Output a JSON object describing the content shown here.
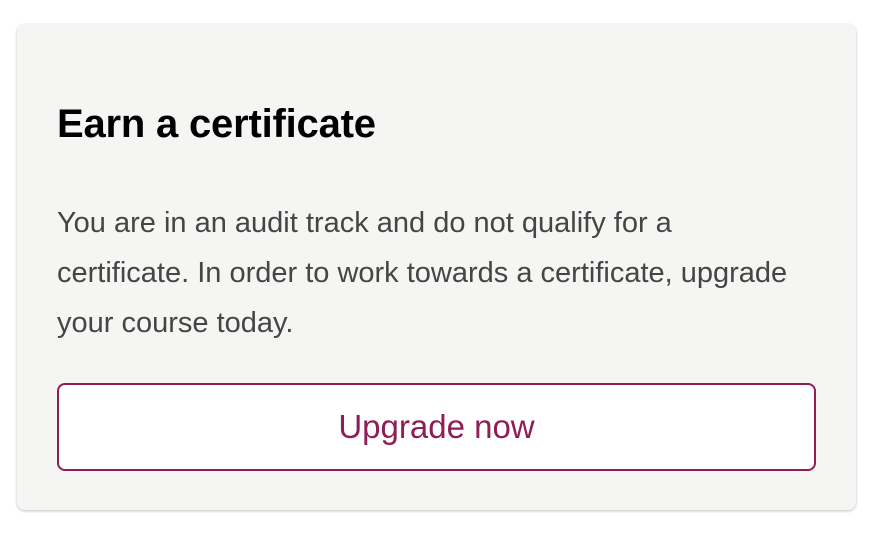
{
  "card": {
    "title": "Earn a certificate",
    "description": "You are in an audit track and do not qualify for a certificate. In order to work towards a certificate, upgrade your course today.",
    "button_label": "Upgrade now"
  },
  "colors": {
    "card_background": "#f5f5f3",
    "accent": "#8f1d56",
    "title_text": "#000000",
    "body_text": "#454545"
  }
}
